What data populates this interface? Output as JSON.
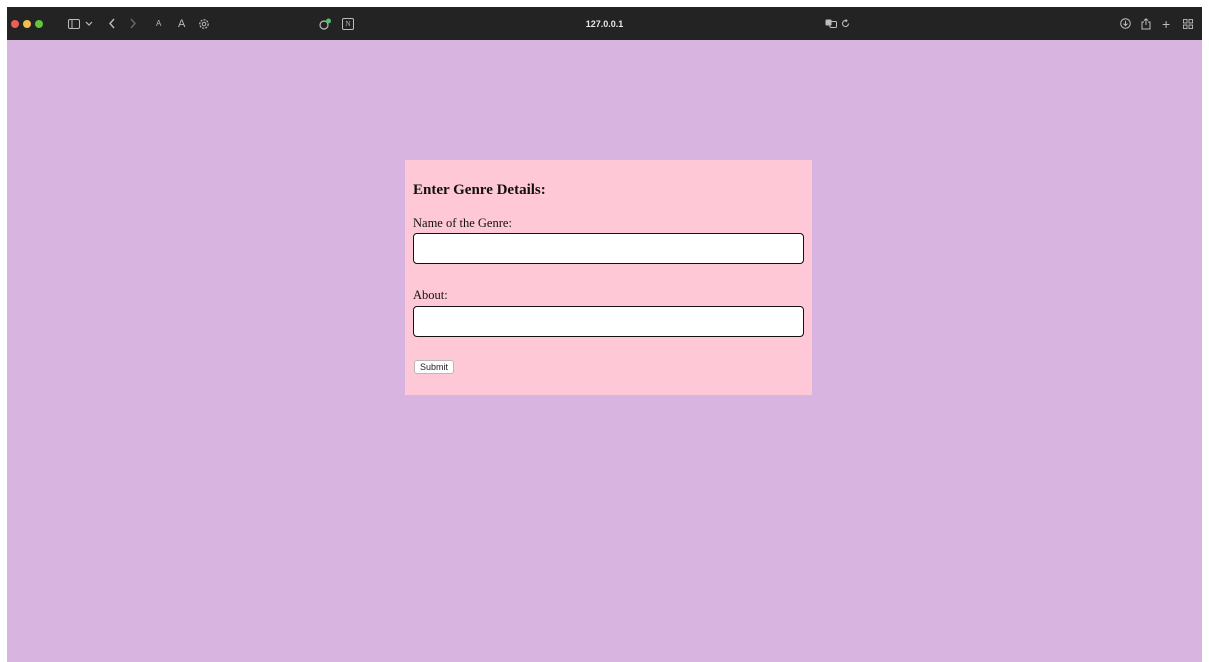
{
  "browser": {
    "url": "127.0.0.1",
    "icons": {
      "sidebar": "sidebar-icon",
      "back": "chevron-left-icon",
      "forward": "chevron-right-icon",
      "text_small": "A",
      "text_large": "A",
      "settings": "gear-icon",
      "extension": "extension-icon",
      "notion": "N",
      "translate": "translate-icon",
      "reload": "reload-icon",
      "download": "download-icon",
      "share": "share-icon",
      "new_tab": "+",
      "tab_overview": "tab-overview-icon"
    }
  },
  "form": {
    "title": "Enter Genre Details:",
    "name_label": "Name of the Genre:",
    "name_value": "",
    "about_label": "About:",
    "about_value": "",
    "submit_label": "Submit"
  },
  "colors": {
    "page_background": "#d8b4e0",
    "form_background": "#fec8d6",
    "toolbar": "#232323"
  }
}
